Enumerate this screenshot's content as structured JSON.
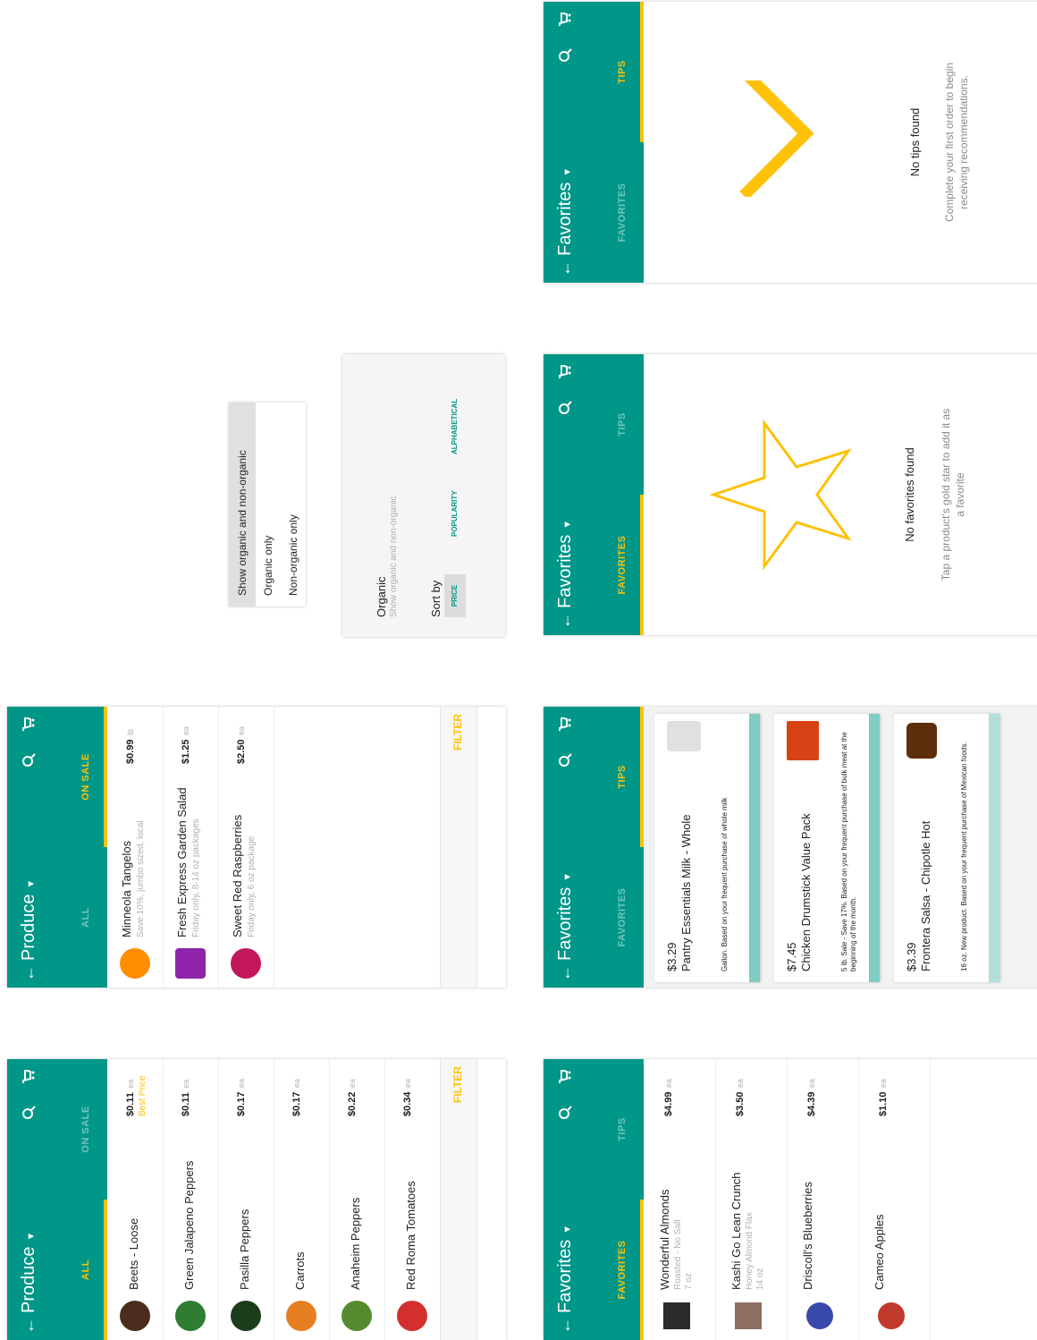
{
  "colors": {
    "primary": "#009688",
    "accent": "#ffc107",
    "teal_light": "#80cbc4",
    "text": "#222222",
    "muted": "#b0b0b0"
  },
  "icons": {
    "back": "arrow-back-icon",
    "search": "search-icon",
    "cart": "cart-icon",
    "dropdown": "caret-down-icon"
  },
  "screen1": {
    "title": "Produce",
    "tabs": [
      "ALL",
      "ON SALE"
    ],
    "items": [
      {
        "name": "Beets - Loose",
        "sub": "",
        "price": "$0.11",
        "unit": "ea",
        "badge": "Best Price",
        "thumb_color": "#4a2d1d"
      },
      {
        "name": "Green Jalapeno Peppers",
        "sub": "",
        "price": "$0.11",
        "unit": "ea",
        "badge": "",
        "thumb_color": "#2e7d32"
      },
      {
        "name": "Pasilla Peppers",
        "sub": "",
        "price": "$0.17",
        "unit": "ea",
        "badge": "",
        "thumb_color": "#1b3d1b"
      },
      {
        "name": "Carrots",
        "sub": "",
        "price": "$0.17",
        "unit": "ea",
        "badge": "",
        "thumb_color": "#e67e22"
      },
      {
        "name": "Anaheim Peppers",
        "sub": "",
        "price": "$0.22",
        "unit": "ea",
        "badge": "",
        "thumb_color": "#558b2f"
      },
      {
        "name": "Red Roma Tomatoes",
        "sub": "",
        "price": "$0.34",
        "unit": "ea",
        "badge": "",
        "thumb_color": "#d32f2f"
      }
    ],
    "filter": "FILTER"
  },
  "screen2": {
    "title": "Produce",
    "tabs": [
      "ALL",
      "ON SALE"
    ],
    "items": [
      {
        "name": "Minneola Tangelos",
        "sub": "Save 10%, jumbo sized, local",
        "price": "$0.99",
        "unit": "lb",
        "thumb_color": "#ff8f00"
      },
      {
        "name": "Fresh Express Garden Salad",
        "sub": "Friday only, 8-14 oz packages",
        "price": "$1.25",
        "unit": "ea",
        "thumb_color": "#8e24aa"
      },
      {
        "name": "Sweet Red Raspberries",
        "sub": "Friday only, 6 oz package",
        "price": "$2.50",
        "unit": "ea",
        "thumb_color": "#c2185b"
      }
    ],
    "filter": "FILTER"
  },
  "dropdown": {
    "options": [
      "Show organic and non-organic",
      "Organic only",
      "Non-organic only"
    ],
    "selected_index": 0
  },
  "filter_panel": {
    "organic_label": "Organic",
    "organic_value": "Show organic and non-organic",
    "sort_label": "Sort by",
    "sort_options": [
      "PRICE",
      "POPULARITY",
      "ALPHABETICAL"
    ],
    "sort_selected": "PRICE"
  },
  "screen3": {
    "title": "Favorites",
    "tabs": [
      "FAVORITES",
      "TIPS"
    ],
    "items": [
      {
        "name": "Wonderful Almonds",
        "sub1": "Roasted - No Salt",
        "sub2": "7 oz",
        "price": "$4.99",
        "unit": "ea",
        "thumb_color": "#2b2b2b"
      },
      {
        "name": "Kashi Go Lean Crunch",
        "sub1": "Honey Almond Flax",
        "sub2": "14 oz",
        "price": "$3.50",
        "unit": "ea",
        "thumb_color": "#8d6e63"
      },
      {
        "name": "Driscoll's Blueberries",
        "sub1": "",
        "sub2": "",
        "price": "$4.39",
        "unit": "ea",
        "thumb_color": "#3949ab"
      },
      {
        "name": "Cameo Apples",
        "sub1": "",
        "sub2": "",
        "price": "$1.10",
        "unit": "ea",
        "thumb_color": "#c0392b"
      }
    ]
  },
  "screen4": {
    "title": "Favorites",
    "tabs": [
      "FAVORITES",
      "TIPS"
    ],
    "cards": [
      {
        "price": "$3.29",
        "name": "Pantry Essentials Milk - Whole",
        "desc": "Gallon.  Based on your frequent purchase of whole milk",
        "thumb_color": "#e0e0e0"
      },
      {
        "price": "$7.45",
        "name": "Chicken Drumstick Value Pack",
        "desc": "5 lb.  Sale - Save 17%.  Based on your frequent purchase of bulk meat at the beginning of the month.",
        "thumb_color": "#d84315"
      },
      {
        "price": "$3.39",
        "name": "Frontera Salsa - Chipotle Hot",
        "desc": "16 oz.  New product.  Based on your frequent purchase of Mexican foods.",
        "thumb_color": "#5d2e0c"
      }
    ]
  },
  "screen5": {
    "title": "Favorites",
    "tabs": [
      "FAVORITES",
      "TIPS"
    ],
    "empty_title": "No favorites found",
    "empty_msg": "Tap a product's gold star to add it as a favorite"
  },
  "screen6": {
    "title": "Favorites",
    "tabs": [
      "FAVORITES",
      "TIPS"
    ],
    "empty_title": "No tips found",
    "empty_msg": "Complete your first order to begin receiving recommendations."
  }
}
